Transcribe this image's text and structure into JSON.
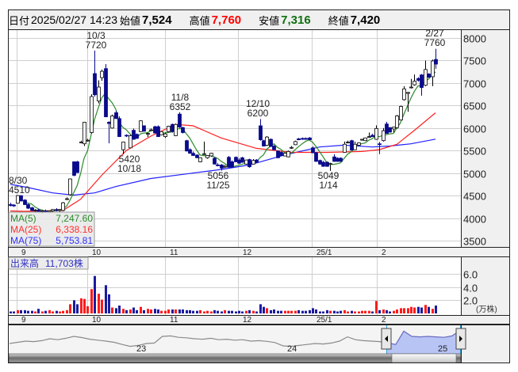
{
  "header": {
    "date_label": "日付",
    "datetime": "2025/02/27 14:23",
    "open_label": "始値",
    "open": "7,524",
    "high_label": "高値",
    "high": "7,760",
    "low_label": "安値",
    "low": "7,316",
    "close_label": "終値",
    "close": "7,420"
  },
  "colors": {
    "up_candle": "#ffffff",
    "down_candle": "#0a0a8c",
    "ma5": "#2a8a2a",
    "ma25": "#ff2020",
    "ma75": "#2020ff",
    "vol_up": "#ff1a1a",
    "vol_down": "#1a1aa0",
    "high": "#ff0000",
    "low": "#107010",
    "nav_fill": "#b8c4f4"
  },
  "legend": {
    "ma5": "MA(5)",
    "ma5_value": "7,247.60",
    "ma25": "MA(25)",
    "ma25_value": "6,338.16",
    "ma75": "MA(75)",
    "ma75_value": "5,753.81"
  },
  "volume_label": "出来高",
  "volume_value": "11,703株",
  "volume_unit": "(万株)",
  "annotations": [
    {
      "date": "8/30",
      "price": "4510"
    },
    {
      "date": "10/3",
      "price": "7720"
    },
    {
      "date": "10/18",
      "price": "5420"
    },
    {
      "date": "11/8",
      "price": "6352"
    },
    {
      "date": "11/25",
      "price": "5056"
    },
    {
      "date": "12/10",
      "price": "6200"
    },
    {
      "date": "1/14",
      "price": "5049"
    },
    {
      "date": "2/27",
      "price": "7760"
    }
  ],
  "navigator": {
    "year_labels": [
      "23",
      "24",
      "25"
    ],
    "series": [
      5600,
      5650,
      5700,
      5680,
      5720,
      5800,
      5760,
      5820,
      5900,
      5850,
      5780,
      5740,
      5700,
      5650,
      5560,
      5480,
      5520,
      5600,
      5620,
      5900,
      5920,
      5860,
      5840,
      5800,
      5780,
      5820,
      5760,
      5780,
      5740,
      5760,
      5700,
      5720,
      5690,
      5640,
      5500,
      5480,
      5520,
      5560,
      5600,
      5580,
      5620,
      5700,
      5880,
      5760,
      5720,
      5700,
      5680,
      5620,
      5560,
      6120,
      5900,
      5880,
      5900,
      5880,
      5860,
      5920,
      6150
    ]
  },
  "chart_data": {
    "type": "candlestick",
    "title": "",
    "y_axis": {
      "ticks": [
        8000,
        7500,
        7000,
        6500,
        6000,
        5500,
        5000,
        4500,
        4000,
        3500
      ],
      "range": [
        3500,
        8000
      ]
    },
    "x_ticks": [
      "9",
      "10",
      "11",
      "12",
      "25/1",
      "2"
    ],
    "volume_axis": {
      "ticks": [
        "6.0",
        "4.0",
        "2.0"
      ],
      "unit": "万株"
    },
    "ohlc": [
      [
        4300,
        4340,
        4260,
        4280
      ],
      [
        4290,
        4310,
        4250,
        4270
      ],
      [
        4330,
        4510,
        4320,
        4500
      ],
      [
        4500,
        4500,
        4370,
        4380
      ],
      [
        4400,
        4420,
        4290,
        4300
      ],
      [
        4300,
        4320,
        4200,
        4220
      ],
      [
        4230,
        4250,
        4150,
        4170
      ],
      [
        4170,
        4200,
        4120,
        4180
      ],
      [
        4180,
        4210,
        4140,
        4150
      ],
      [
        4150,
        4180,
        4100,
        4160
      ],
      [
        4160,
        4190,
        4120,
        4140
      ],
      [
        4140,
        4170,
        4110,
        4160
      ],
      [
        4160,
        4200,
        4140,
        4190
      ],
      [
        4190,
        4220,
        4150,
        4170
      ],
      [
        4170,
        4200,
        4140,
        4190
      ],
      [
        4170,
        4360,
        4150,
        4340
      ],
      [
        4420,
        4460,
        4400,
        4430
      ],
      [
        4520,
        4880,
        4500,
        4870
      ],
      [
        5250,
        5260,
        4930,
        4950
      ],
      [
        5250,
        5270,
        5000,
        5010
      ],
      [
        5680,
        5720,
        5660,
        5690
      ],
      [
        5650,
        6140,
        5600,
        6130
      ],
      [
        5720,
        5760,
        5700,
        5730
      ],
      [
        5900,
        6750,
        5880,
        6700
      ],
      [
        7210,
        7720,
        6700,
        6740
      ],
      [
        6600,
        7060,
        6550,
        6910
      ],
      [
        7120,
        7300,
        7050,
        7260
      ],
      [
        7320,
        7420,
        6240,
        6250
      ],
      [
        6130,
        6150,
        5660,
        6100
      ],
      [
        6000,
        6300,
        5990,
        6270
      ],
      [
        6340,
        6380,
        6200,
        6210
      ],
      [
        6210,
        6260,
        5800,
        5810
      ],
      [
        5520,
        5700,
        5420,
        5690
      ],
      [
        5840,
        5860,
        5800,
        5830
      ],
      [
        5560,
        5850,
        5550,
        5830
      ],
      [
        5950,
        5990,
        5740,
        5750
      ],
      [
        5860,
        5880,
        5760,
        5770
      ],
      [
        5920,
        6170,
        5910,
        6160
      ],
      [
        6050,
        6060,
        5920,
        5930
      ],
      [
        5870,
        5900,
        5800,
        5880
      ],
      [
        5960,
        5990,
        5930,
        5960
      ],
      [
        6030,
        6050,
        5880,
        5890
      ],
      [
        6030,
        6060,
        5800,
        5810
      ],
      [
        5850,
        5930,
        5840,
        5920
      ],
      [
        5810,
        5900,
        5780,
        5870
      ],
      [
        5920,
        6050,
        5900,
        6040
      ],
      [
        6080,
        6100,
        5900,
        5920
      ],
      [
        5830,
        6100,
        5820,
        6080
      ],
      [
        6310,
        6352,
        6000,
        6020
      ],
      [
        6010,
        6030,
        5880,
        5900
      ],
      [
        5720,
        5740,
        5480,
        5490
      ],
      [
        5520,
        5550,
        5430,
        5440
      ],
      [
        5440,
        5480,
        5380,
        5390
      ],
      [
        5400,
        5420,
        5330,
        5340
      ],
      [
        5250,
        5350,
        5240,
        5340
      ],
      [
        5420,
        5700,
        5400,
        5430
      ],
      [
        5340,
        5400,
        5320,
        5390
      ],
      [
        5380,
        5450,
        5360,
        5440
      ],
      [
        5330,
        5350,
        5190,
        5200
      ],
      [
        5180,
        5220,
        5150,
        5170
      ],
      [
        5180,
        5200,
        5056,
        5110
      ],
      [
        5140,
        5180,
        5110,
        5150
      ],
      [
        5350,
        5380,
        5120,
        5130
      ],
      [
        5250,
        5280,
        5120,
        5130
      ],
      [
        5350,
        5370,
        5240,
        5250
      ],
      [
        5290,
        5330,
        5200,
        5220
      ],
      [
        5340,
        5360,
        5230,
        5240
      ],
      [
        5200,
        5300,
        5190,
        5290
      ],
      [
        5300,
        5320,
        5120,
        5140
      ],
      [
        5200,
        5310,
        5190,
        5280
      ],
      [
        5290,
        5310,
        5220,
        5240
      ],
      [
        6050,
        6200,
        5720,
        5740
      ],
      [
        5720,
        5740,
        5590,
        5600
      ],
      [
        5620,
        5820,
        5600,
        5800
      ],
      [
        5750,
        5770,
        5580,
        5590
      ],
      [
        5600,
        5620,
        5510,
        5520
      ],
      [
        5490,
        5500,
        5330,
        5340
      ],
      [
        5460,
        5480,
        5380,
        5390
      ],
      [
        5380,
        5450,
        5370,
        5440
      ],
      [
        5360,
        5500,
        5350,
        5480
      ],
      [
        5570,
        5600,
        5540,
        5570
      ],
      [
        5630,
        5720,
        5620,
        5700
      ],
      [
        5760,
        5780,
        5730,
        5740
      ],
      [
        5770,
        5790,
        5740,
        5750
      ],
      [
        5770,
        5790,
        5740,
        5750
      ],
      [
        5780,
        5800,
        5730,
        5740
      ],
      [
        5560,
        5590,
        5440,
        5450
      ],
      [
        5450,
        5470,
        5250,
        5260
      ],
      [
        5280,
        5300,
        5180,
        5200
      ],
      [
        5240,
        5270,
        5140,
        5150
      ],
      [
        5240,
        5260,
        5140,
        5150
      ],
      [
        5200,
        5230,
        5049,
        5210
      ],
      [
        5360,
        5420,
        5250,
        5260
      ],
      [
        5330,
        5350,
        5250,
        5260
      ],
      [
        5330,
        5350,
        5250,
        5260
      ],
      [
        5460,
        5700,
        5450,
        5640
      ],
      [
        5680,
        5720,
        5660,
        5690
      ],
      [
        5720,
        5740,
        5500,
        5510
      ],
      [
        5520,
        5700,
        5510,
        5640
      ],
      [
        5620,
        5680,
        5610,
        5670
      ],
      [
        5740,
        5760,
        5720,
        5750
      ],
      [
        5720,
        5790,
        5710,
        5780
      ],
      [
        5800,
        5900,
        5780,
        5810
      ],
      [
        5840,
        5870,
        5800,
        5810
      ],
      [
        5750,
        6060,
        5740,
        5990
      ],
      [
        5650,
        5690,
        5420,
        5640
      ],
      [
        5720,
        6000,
        5700,
        5940
      ],
      [
        6090,
        6140,
        5870,
        5880
      ],
      [
        6010,
        6020,
        5900,
        5910
      ],
      [
        5980,
        6030,
        5900,
        6020
      ],
      [
        6010,
        6290,
        5990,
        6270
      ],
      [
        6180,
        6500,
        6170,
        6480
      ],
      [
        6630,
        6930,
        6610,
        6870
      ],
      [
        6770,
        6800,
        6360,
        6790
      ],
      [
        6900,
        7090,
        6880,
        6910
      ],
      [
        6960,
        7190,
        6940,
        7040
      ],
      [
        7100,
        7130,
        7030,
        7060
      ],
      [
        7180,
        7200,
        6720,
        6900
      ],
      [
        6950,
        7500,
        6930,
        7300
      ],
      [
        7200,
        7220,
        7110,
        7130
      ],
      [
        7140,
        7520,
        6930,
        7490
      ],
      [
        7524,
        7760,
        7316,
        7420
      ]
    ],
    "volume": [
      0.3,
      0.3,
      0.5,
      0.5,
      0.5,
      0.4,
      0.4,
      0.3,
      0.7,
      0.3,
      0.4,
      0.5,
      0.3,
      0.4,
      0.3,
      0.4,
      0.5,
      1.4,
      2.0,
      1.4,
      2.3,
      2.2,
      1.1,
      3.7,
      5.7,
      3.0,
      2.1,
      4.3,
      2.9,
      0.9,
      0.8,
      1.2,
      0.7,
      0.5,
      0.6,
      0.9,
      0.5,
      1.0,
      0.5,
      0.7,
      0.6,
      0.7,
      0.6,
      0.4,
      0.4,
      0.6,
      0.6,
      0.6,
      0.6,
      0.6,
      0.5,
      0.5,
      0.4,
      0.4,
      0.5,
      0.3,
      0.4,
      0.3,
      0.5,
      0.4,
      0.3,
      0.5,
      0.4,
      0.4,
      0.3,
      0.4,
      0.3,
      0.4,
      0.5,
      0.4,
      0.3,
      1.4,
      1.0,
      0.8,
      0.5,
      0.6,
      0.4,
      0.4,
      0.4,
      0.4,
      0.4,
      0.4,
      0.5,
      0.4,
      0.4,
      0.5,
      0.8,
      0.6,
      0.3,
      0.3,
      0.5,
      0.4,
      0.4,
      0.3,
      0.4,
      0.5,
      0.3,
      0.4,
      0.3,
      0.3,
      0.4,
      0.4,
      0.4,
      0.3,
      1.9,
      0.5,
      0.6,
      0.5,
      0.3,
      0.4,
      0.6,
      0.8,
      0.8,
      0.8,
      1.0,
      0.9,
      1.0,
      0.9,
      1.3,
      1.0,
      0.7,
      1.2
    ],
    "ma25": [
      [
        0,
        4160
      ],
      [
        4,
        4150
      ],
      [
        15,
        4170
      ],
      [
        20,
        4420
      ],
      [
        26,
        4950
      ],
      [
        33,
        5500
      ],
      [
        40,
        5820
      ],
      [
        47,
        6080
      ],
      [
        52,
        6050
      ],
      [
        60,
        5780
      ],
      [
        70,
        5550
      ],
      [
        80,
        5460
      ],
      [
        90,
        5460
      ],
      [
        100,
        5480
      ],
      [
        105,
        5520
      ],
      [
        110,
        5640
      ],
      [
        115,
        5950
      ],
      [
        121,
        6338.16
      ]
    ],
    "ma75": [
      [
        0,
        4750
      ],
      [
        5,
        4680
      ],
      [
        12,
        4560
      ],
      [
        18,
        4510
      ],
      [
        24,
        4560
      ],
      [
        30,
        4700
      ],
      [
        40,
        4880
      ],
      [
        50,
        4980
      ],
      [
        60,
        5080
      ],
      [
        68,
        5180
      ],
      [
        78,
        5400
      ],
      [
        88,
        5580
      ],
      [
        95,
        5620
      ],
      [
        103,
        5580
      ],
      [
        108,
        5600
      ],
      [
        114,
        5650
      ],
      [
        121,
        5753.81
      ]
    ]
  }
}
